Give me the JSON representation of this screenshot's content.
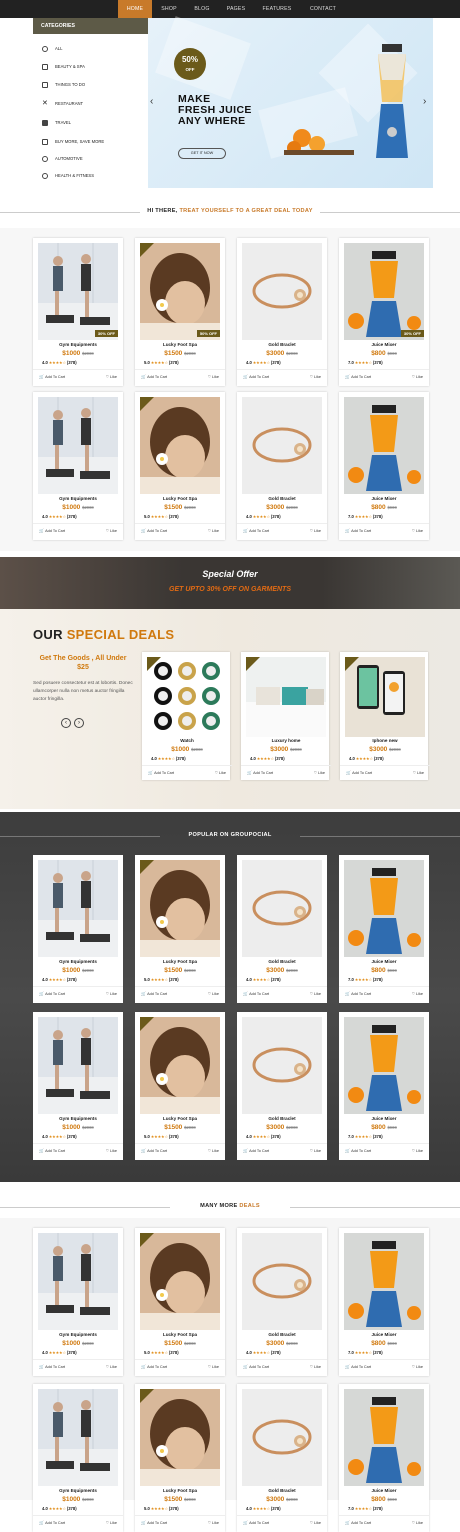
{
  "nav": [
    "HOME",
    "SHOP",
    "BLOG",
    "PAGES",
    "FEATURES",
    "CONTACT"
  ],
  "categories": {
    "title": "CATEGORIES",
    "items": [
      "ALL",
      "BEAUTY & SPA",
      "THINGS TO DO",
      "RESTAURANT",
      "TRAVEL",
      "BUY MORE, SAVE MORE",
      "AUTOMOTIVE",
      "HEALTH & FITNESS"
    ]
  },
  "hero": {
    "badge_value": "50%",
    "badge_label": "OFF",
    "title_1": "MAKE",
    "title_2": "FRESH JUICE",
    "title_3": "ANY WHERE",
    "button": "GET IT NOW"
  },
  "section1": {
    "part1": "HI THERE, ",
    "part2": "TREAT YOURSELF TO A GREAT DEAL TODAY"
  },
  "special": {
    "title": "Special Offer",
    "subtitle": "GET UPTO 30% OFF ON GARMENTS"
  },
  "deals": {
    "title_1": "OUR ",
    "title_2": "SPECIAL DEALS",
    "subtitle": "Get The Goods , All Under $25",
    "body": "Sed posuere consectetur est at lobortis. Donec ullamcorper nulla non metus auctor fringilla auctor fringilla."
  },
  "popular": {
    "title": "POPULAR ON GROUPOCIAL"
  },
  "more": {
    "part1": "MANY MORE ",
    "part2": "DEALS"
  },
  "products": [
    {
      "name": "Gym Equipments",
      "price": "$1000",
      "old": "$2000",
      "rating": "4.0",
      "count": "(378)",
      "badge": "30% OFF"
    },
    {
      "name": "Lucky Foot Spa",
      "price": "$1500",
      "old": "$2000",
      "rating": "5.0",
      "count": "(378)",
      "badge": "50% OFF"
    },
    {
      "name": "Gold Braclet",
      "price": "$3000",
      "old": "$2000",
      "rating": "4.0",
      "count": "(378)",
      "badge": ""
    },
    {
      "name": "Juice Mixer",
      "price": "$800",
      "old": "$900",
      "rating": "7.0",
      "count": "(378)",
      "badge": "30% OFF"
    }
  ],
  "deal_products": [
    {
      "name": "Watch",
      "price": "$1000",
      "old": "$2000",
      "rating": "4.0",
      "count": "(378)"
    },
    {
      "name": "Luxury home",
      "price": "$3000",
      "old": "$2000",
      "rating": "4.0",
      "count": "(378)"
    },
    {
      "name": "Iphone new",
      "price": "$3000",
      "old": "$2000",
      "rating": "4.0",
      "count": "(378)"
    }
  ],
  "actions": {
    "cart": "Add To Cart",
    "like": "Like"
  },
  "colors": {
    "accent": "#c87a2a",
    "badge": "#6b5a1a",
    "dark": "#222222",
    "price": "#d0790e"
  }
}
